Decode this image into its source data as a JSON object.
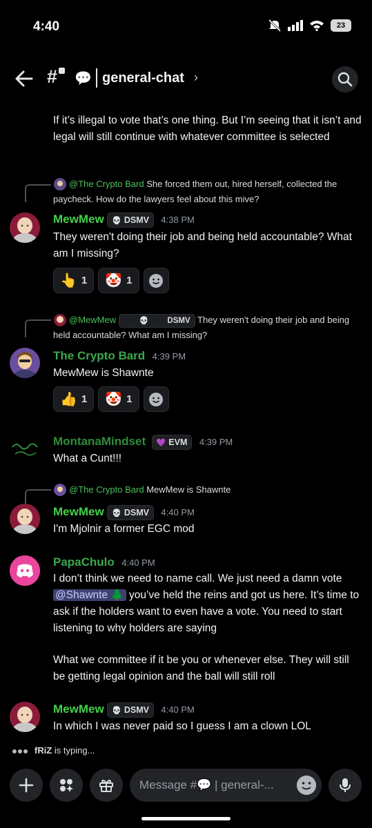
{
  "status": {
    "time": "4:40",
    "battery": "23"
  },
  "header": {
    "hash": "#",
    "emoji": "💬",
    "channel": "general-chat",
    "chevron": "›"
  },
  "messages": {
    "m0": {
      "text": "If it’s illegal to vote that’s one thing. But I’m seeing that it isn’t and legal will still continue with whatever committee is selected"
    },
    "m1": {
      "reply_name": "@The Crypto Bard",
      "reply_text": "She forced them out, hired herself, collected the paycheck.  How do the lawyers feel about this mive?",
      "author": "MewMew",
      "tag": "DSMV",
      "time": "4:38 PM",
      "text": "They weren't doing their job and being held accountable? What am I missing?",
      "reactions": [
        {
          "emoji": "👆",
          "count": "1"
        },
        {
          "emoji": "🤡",
          "count": "1"
        }
      ]
    },
    "m2": {
      "reply_name": "@MewMew",
      "reply_tag": "DSMV",
      "reply_text": "They weren't doing their job and being held accountable? What am I missing?",
      "author": "The Crypto Bard",
      "time": "4:39 PM",
      "text": "MewMew is Shawnte",
      "reactions": [
        {
          "emoji": "👍",
          "count": "1"
        },
        {
          "emoji": "🤡",
          "count": "1"
        }
      ]
    },
    "m3": {
      "author": "MontanaMindset",
      "tag": "EVM",
      "time": "4:39 PM",
      "text": "What a Cunt!!!"
    },
    "m4": {
      "reply_name": "@The Crypto Bard",
      "reply_text": "MewMew is Shawnte",
      "author": "MewMew",
      "tag": "DSMV",
      "time": "4:40 PM",
      "text": "I'm Mjolnir a former EGC mod"
    },
    "m5": {
      "author": "PapaChulo",
      "time": "4:40 PM",
      "text_a": "I don’t think we need to name call. We just need a damn vote",
      "mention": "@Shawnte 🌲",
      "text_b": " you’ve held the reins and got us here. It’s time to ask if the holders want to even have a vote. You need to start listening to why holders are saying",
      "text_c": "What we committee if it be you or whenever else. They will still be getting legal opinion and the ball will still roll"
    },
    "m6": {
      "author": "MewMew",
      "tag": "DSMV",
      "time": "4:40 PM",
      "text": "In which I was never paid so I guess I am a clown LOL"
    }
  },
  "typing": {
    "user": "fRiZ",
    "suffix": " is typing..."
  },
  "composer": {
    "placeholder": "Message #💬 | general-..."
  },
  "colors": {
    "accent_green": "#43d14a",
    "discord_pink": "#eb459e",
    "mention_bg": "#3c4270"
  }
}
